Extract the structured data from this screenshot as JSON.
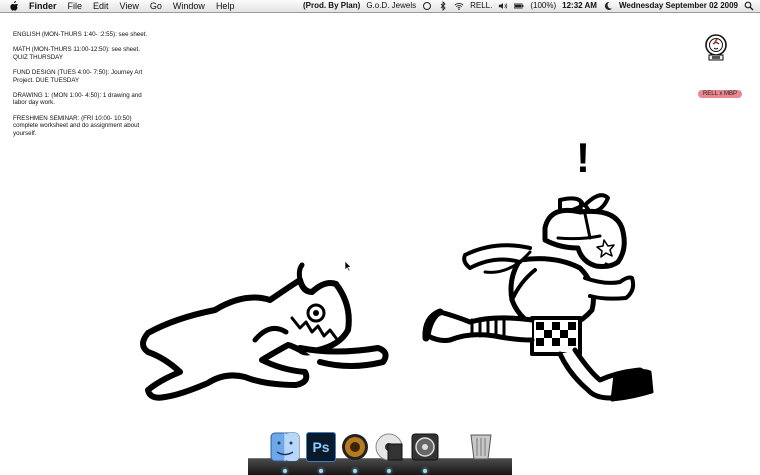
{
  "menubar": {
    "app_name": "Finder",
    "items": [
      "File",
      "Edit",
      "View",
      "Go",
      "Window",
      "Help"
    ],
    "status": {
      "now_playing": "(Prod. By Plan)",
      "artist": "G.o.D. Jewels",
      "user": "RELL.",
      "battery": "(100%)",
      "time": "12:32 AM",
      "date": "Wednesday September 02 2009"
    }
  },
  "notes": [
    "ENGLISH (MON-THURS 1:40- :2:55): see sheet.",
    "MATH (MON-THURS 11:00-12:50): see sheet. QUIZ THURSDAY",
    "FUND DESIGN (TUES 4:00- 7:50): Journey Art Project. DUE TUESDAY",
    "DRAWING 1: (MON 1:00- 4:50): 1 drawing and labor day work.",
    "FRESHMEN SEMINAR: (FRI 10:00- 10:50) complete worksheet and do assignment about yourself."
  ],
  "desktop": {
    "drive_label": "RELL x MBP",
    "exclamation": "!"
  },
  "dock": {
    "icons": [
      "finder-icon",
      "photoshop-icon",
      "itunes-icon",
      "dvd-player-icon",
      "hard-drive-icon",
      "trash-icon"
    ],
    "photoshop_label": "Ps"
  }
}
